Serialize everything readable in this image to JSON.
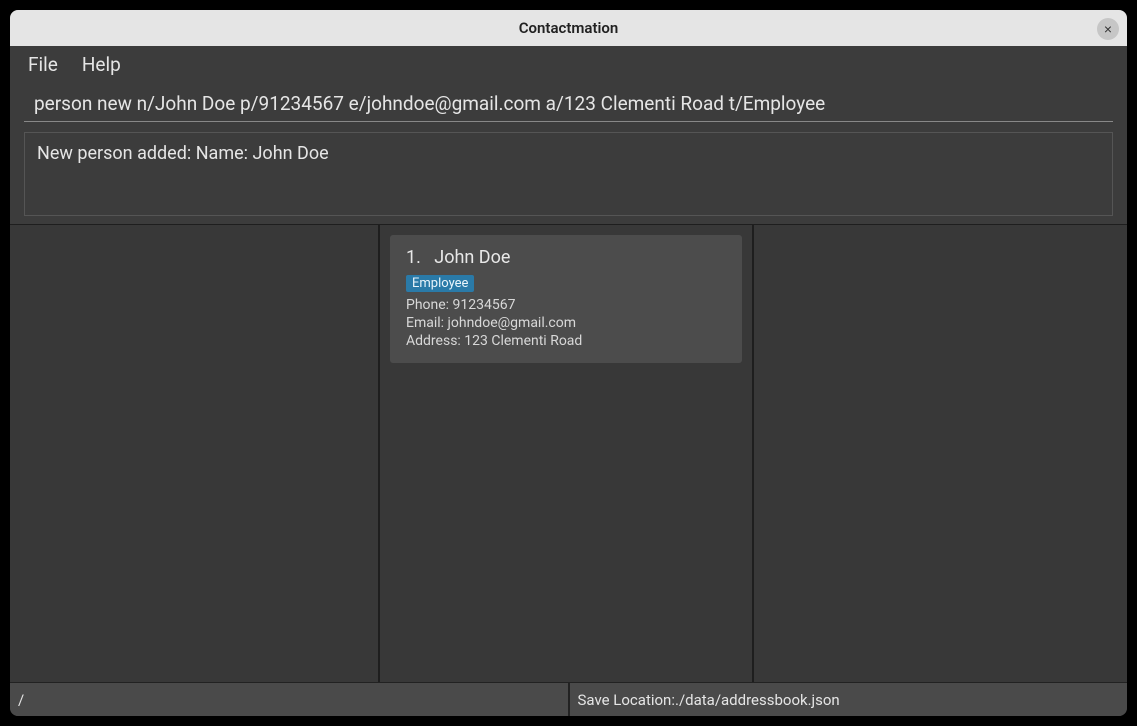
{
  "window": {
    "title": "Contactmation",
    "close_glyph": "×"
  },
  "menu": {
    "file": "File",
    "help": "Help"
  },
  "command_input": {
    "value": "person new n/John Doe p/91234567 e/johndoe@gmail.com a/123 Clementi Road t/Employee"
  },
  "result": {
    "text": "New person added: Name: John Doe"
  },
  "cards": [
    {
      "index": "1.",
      "name": "John Doe",
      "tag": "Employee",
      "phone_label": "Phone: ",
      "phone": "91234567",
      "email_label": "Email: ",
      "email": "johndoe@gmail.com",
      "address_label": "Address: ",
      "address": "123 Clementi Road"
    }
  ],
  "footer": {
    "left": "/",
    "save_label": "Save Location: ",
    "save_path": "./data/addressbook.json"
  }
}
